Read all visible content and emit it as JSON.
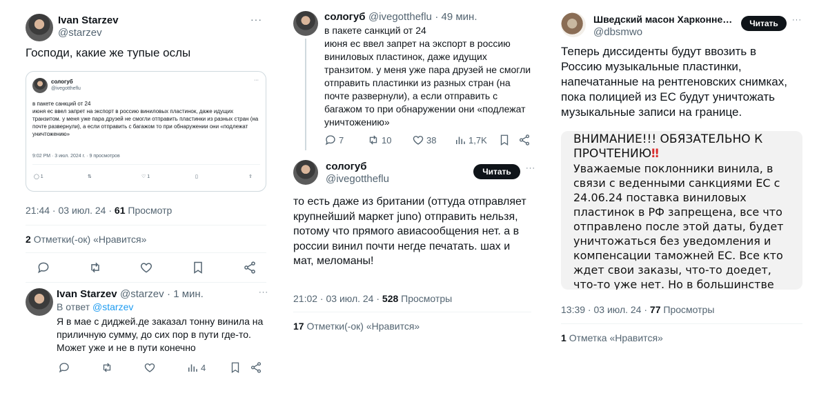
{
  "col1": {
    "tweet": {
      "author_name": "Ivan Starzev",
      "author_handle": "@starzev",
      "text": "Господи, какие же тупые ослы",
      "quote": {
        "author_name": "сологуб",
        "author_handle": "@ivegottheflu",
        "text": "в пакете санкций от 24\nиюня ес ввел запрет на экспорт в россию виниловых пластинок, даже идущих транзитом. у меня уже пара друзей не смогли отправить пластинки из разных стран (на почте развернули), а если отправить с багажом то при обнаружении они «подлежат уничтожению»",
        "timestamp": "9:02 PM · 3 июл. 2024 г. · 9 просмотров",
        "reply_count": "1",
        "like_count": "1"
      },
      "timestamp": "21:44 · 03 июл. 24 ·",
      "views_count": "61",
      "views_label": "Просмотр",
      "likes_count": "2",
      "likes_label": "Отметки(-ок) «Нравится»"
    },
    "reply": {
      "author_name": "Ivan Starzev",
      "author_handle": "@starzev",
      "time": "· 1 мин.",
      "reply_to_label": "В ответ",
      "reply_to_handle": "@starzev",
      "text": "Я в мае с диджей.де заказал тонну винила на приличную сумму, до сих пор в пути где-то. Может уже и не в пути конечно",
      "views": "4"
    }
  },
  "col2": {
    "tweet1": {
      "author_name": "сологуб",
      "author_handle": "@ivegottheflu",
      "time": "· 49 мин.",
      "text": "в пакете санкций от 24\nиюня ес ввел запрет на экспорт в россию виниловых пластинок, даже идущих транзитом. у меня уже пара друзей не смогли отправить пластинки из разных стран (на почте развернули), а если отправить с багажом то при обнаружении они «подлежат уничтожению»",
      "replies": "7",
      "retweets": "10",
      "likes": "38",
      "views": "1,7K"
    },
    "tweet2": {
      "author_name": "сологуб",
      "author_handle": "@ivegottheflu",
      "read_button": "Читать",
      "text": "то есть даже из британии (оттуда отправляет крупнейший маркет juno) отправить нельзя, потому что прямого авиасообщения нет. а в россии винил почти негде печатать. шах и мат, меломаны!",
      "timestamp": "21:02 · 03 июл. 24 ·",
      "views_count": "528",
      "views_label": "Просмотры",
      "likes_count": "17",
      "likes_label": "Отметки(-ок) «Нравится»"
    }
  },
  "col3": {
    "tweet": {
      "author_name": "Шведский масон Харконне…",
      "author_handle": "@dbsmwo",
      "read_button": "Читать",
      "text": "Теперь диссиденты будут ввозить в Россию музыкальные пластинки, напечатанные на рентгеновских снимках, пока полицией из ЕС будут уничтожать музыкальные записи на границе.",
      "notice_title": "ВНИМАНИЕ!!! ОБЯЗАТЕЛЬНО К ПРОЧТЕНИЮ",
      "notice_mark": "‼",
      "notice_body": "Уважаемые поклонники винила, в связи с веденными санкциями ЕС с 24.06.24 поставка виниловых пластинок в РФ запрещена, все что отправлено после этой даты, будет уничтожаться без уведомления и компенсации таможней ЕС. Все кто ждет свои заказы, что-то доедет, что-то уже нет. Но в большинстве",
      "timestamp": "13:39 · 03 июл. 24 ·",
      "views_count": "77",
      "views_label": "Просмотры",
      "likes_count": "1",
      "likes_label": "Отметка «Нравится»"
    }
  },
  "colors": {
    "text": "#0f1419",
    "secondary": "#536471",
    "link": "#1d9bf0",
    "border": "#cfd9de",
    "button": "#0f1419"
  }
}
